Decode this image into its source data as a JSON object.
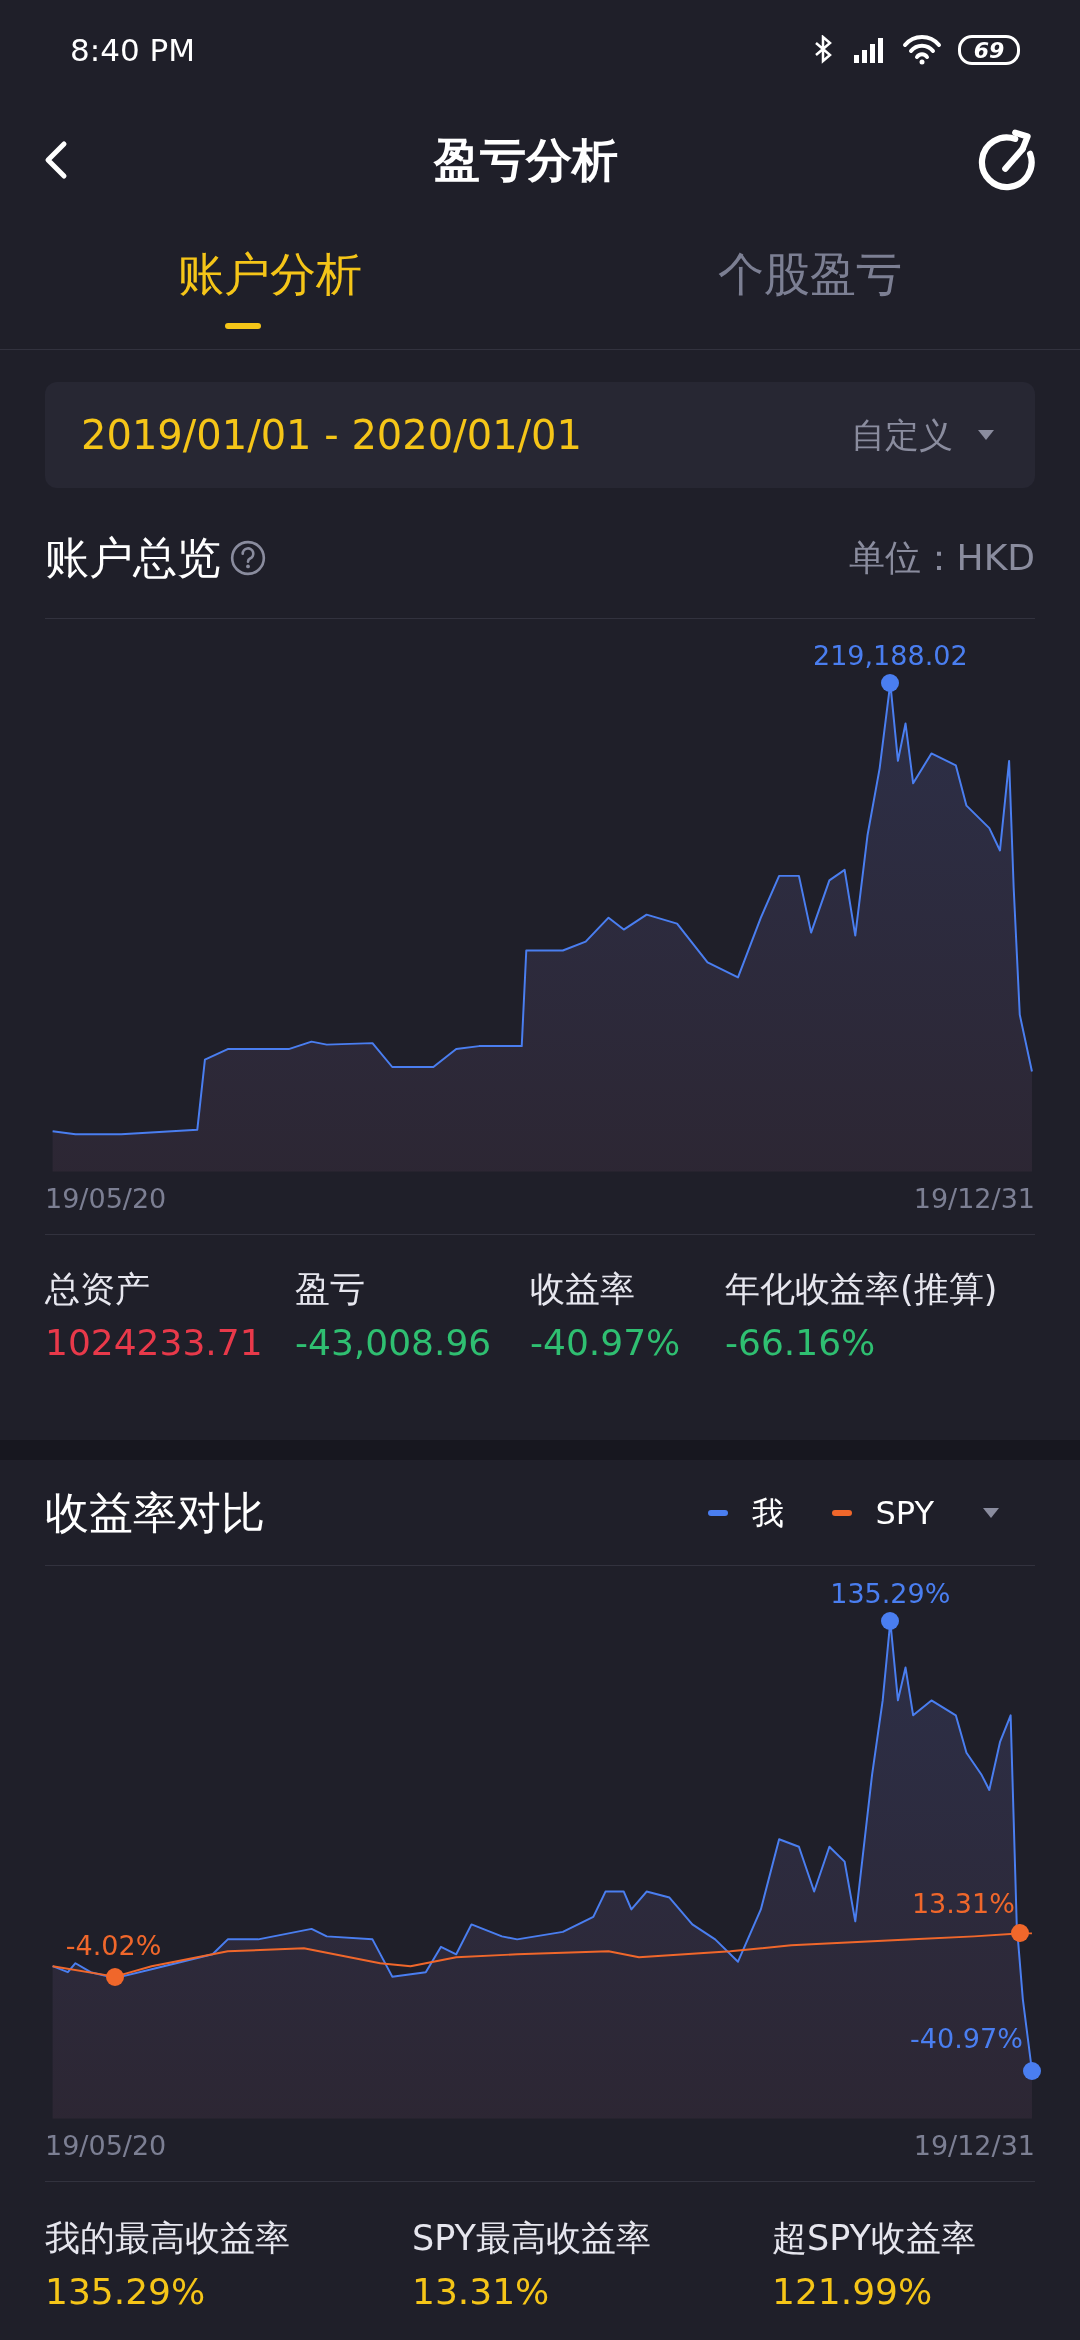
{
  "status_bar": {
    "time": "8:40 PM",
    "battery": "69"
  },
  "header": {
    "title": "盈亏分析"
  },
  "tabs": [
    {
      "label": "账户分析",
      "selected": true
    },
    {
      "label": "个股盈亏",
      "selected": false
    }
  ],
  "date_range": {
    "value": "2019/01/01 - 2020/01/01",
    "mode": "自定义"
  },
  "overview": {
    "title": "账户总览",
    "unit": "单位：HKD",
    "peak_label": "219,188.02",
    "x_start": "19/05/20",
    "x_end": "19/12/31",
    "stats": [
      {
        "label": "总资产",
        "value": "1024233.71",
        "color": "#e8394a"
      },
      {
        "label": "盈亏",
        "value": "-43,008.96",
        "color": "#2fbf71"
      },
      {
        "label": "收益率",
        "value": "-40.97%",
        "color": "#2fbf71"
      },
      {
        "label": "年化收益率(推算)",
        "value": "-66.16%",
        "color": "#2fbf71"
      }
    ]
  },
  "comparison": {
    "title": "收益率对比",
    "legend": [
      {
        "label": "我",
        "color": "#4a7ef0"
      },
      {
        "label": "SPY",
        "color": "#f0672b"
      }
    ],
    "labels": {
      "me_max": "135.29%",
      "me_end": "-40.97%",
      "spy_min": "-4.02%",
      "spy_end": "13.31%"
    },
    "x_start": "19/05/20",
    "x_end": "19/12/31",
    "stats": [
      {
        "label": "我的最高收益率",
        "value": "135.29%"
      },
      {
        "label": "SPY最高收益率",
        "value": "13.31%"
      },
      {
        "label": "超SPY收益率",
        "value": "121.99%"
      }
    ]
  }
}
